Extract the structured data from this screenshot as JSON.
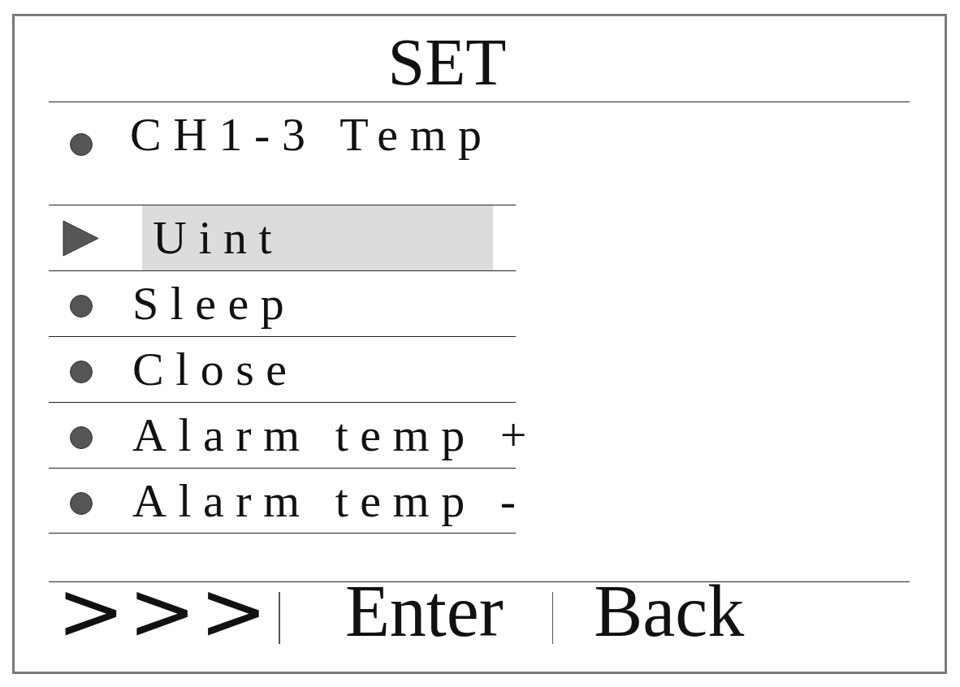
{
  "title": "SET",
  "header_item": {
    "label": "CH1-3 Temp"
  },
  "menu_items": [
    {
      "label": "Uint",
      "selected": true
    },
    {
      "label": "Sleep",
      "selected": false
    },
    {
      "label": "Close",
      "selected": false
    },
    {
      "label": "Alarm temp +",
      "selected": false
    },
    {
      "label": "Alarm temp -",
      "selected": false
    }
  ],
  "softkeys": [
    {
      "kind": "arrows",
      "label": ">>>"
    },
    {
      "kind": "text",
      "label": "Enter"
    },
    {
      "kind": "text",
      "label": "Back"
    }
  ]
}
